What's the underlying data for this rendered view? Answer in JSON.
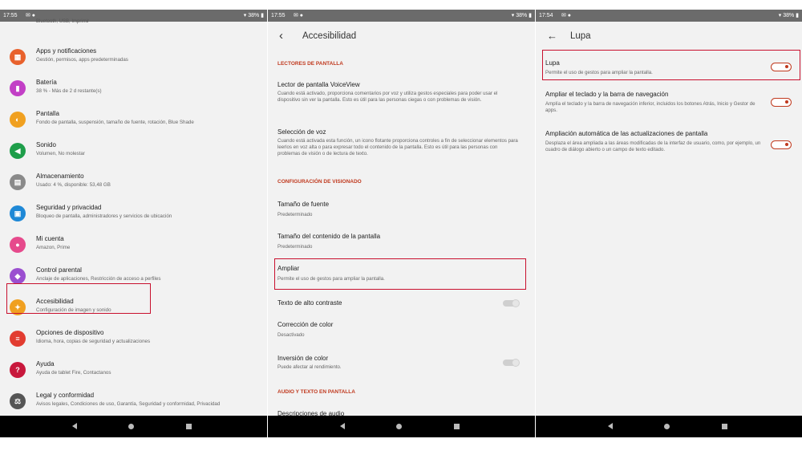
{
  "colors": {
    "accent": "#c0391e",
    "highlight": "#c8102e",
    "status_bar": "#6b6b6b",
    "nav_bar": "#000000"
  },
  "panel1": {
    "status": {
      "time": "17:55",
      "battery": "38%"
    },
    "cut_text": "Bluetooth, USB, Imprimir",
    "items": [
      {
        "title": "Apps y notificaciones",
        "subtitle": "Gestión, permisos, apps predeterminadas",
        "icon": "apps-icon",
        "color": "#e8612c"
      },
      {
        "title": "Batería",
        "subtitle": "38 % - Más de 2 d restante(s)",
        "icon": "battery-icon",
        "color": "#c23fc6"
      },
      {
        "title": "Pantalla",
        "subtitle": "Fondo de pantalla, suspensión, tamaño de fuente, rotación, Blue Shade",
        "icon": "display-icon",
        "color": "#f0a020"
      },
      {
        "title": "Sonido",
        "subtitle": "Volumen, No molestar",
        "icon": "sound-icon",
        "color": "#1e9e4a"
      },
      {
        "title": "Almacenamiento",
        "subtitle": "Usado: 4 %, disponible: 53,48 GB",
        "icon": "storage-icon",
        "color": "#8a8a8a"
      },
      {
        "title": "Seguridad y privacidad",
        "subtitle": "Bloqueo de pantalla, administradores y servicios de ubicación",
        "icon": "lock-icon",
        "color": "#1e88d6"
      },
      {
        "title": "Mi cuenta",
        "subtitle": "Amazon, Prime",
        "icon": "account-icon",
        "color": "#e64a8c"
      },
      {
        "title": "Control parental",
        "subtitle": "Anclaje de aplicaciones, Restricción de acceso a perfiles",
        "icon": "parental-icon",
        "color": "#9b4fd0"
      },
      {
        "title": "Accesibilidad",
        "subtitle": "Configuración de imagen y sonido",
        "icon": "accessibility-icon",
        "color": "#f0a020"
      },
      {
        "title": "Opciones de dispositivo",
        "subtitle": "Idioma, hora, copias de seguridad y actualizaciones",
        "icon": "device-options-icon",
        "color": "#e23c30"
      },
      {
        "title": "Ayuda",
        "subtitle": "Ayuda de tablet Fire, Contactanos",
        "icon": "help-icon",
        "color": "#c8183c"
      },
      {
        "title": "Legal y conformidad",
        "subtitle": "Avisos legales, Condiciones de uso, Garantía, Seguridad y conformidad, Privacidad",
        "icon": "legal-icon",
        "color": "#555555"
      }
    ]
  },
  "panel2": {
    "status": {
      "time": "17:55",
      "battery": "38%"
    },
    "title": "Accesibilidad",
    "section_screen_readers": "LECTORES DE PANTALLA",
    "voiceview_title": "Lector de pantalla VoiceView",
    "voiceview_sub": "Cuando está activado, proporciona comentarios por voz y utiliza gestos especiales para poder usar el dispositivo sin ver la pantalla. Esto es útil para las personas ciegas o con problemas de visión.",
    "voice_select_title": "Selección de voz",
    "voice_select_sub": "Cuando está activada esta función, un icono flotante proporciona controles a fin de seleccionar elementos para leerlos en voz alta o para expresar todo el contenido de la pantalla. Esto es útil para las personas con problemas de visión o de lectura de texto.",
    "section_display": "CONFIGURACIÓN DE VISIONADO",
    "font_size_title": "Tamaño de fuente",
    "font_size_sub": "Predeterminado",
    "content_size_title": "Tamaño del contenido de la pantalla",
    "content_size_sub": "Predeterminado",
    "magnify_title": "Ampliar",
    "magnify_sub": "Permite el uso de gestos para ampliar la pantalla.",
    "high_contrast_title": "Texto de alto contraste",
    "color_correction_title": "Corrección de color",
    "color_correction_sub": "Desactivado",
    "color_inversion_title": "Inversión de color",
    "color_inversion_sub": "Puede afectar al rendimiento.",
    "section_audio": "AUDIO Y TEXTO EN PANTALLA",
    "audio_desc_title": "Descripciones de audio"
  },
  "panel3": {
    "status": {
      "time": "17:54",
      "battery": "38%"
    },
    "title": "Lupa",
    "lupa_title": "Lupa",
    "lupa_sub": "Permite el uso de gestos para ampliar la pantalla.",
    "keyboard_title": "Ampliar el teclado y la barra de navegación",
    "keyboard_sub": "Amplía el teclado y la barra de navegación inferior, incluidos los botones Atrás, Inicio y Gestor de apps.",
    "auto_title": "Ampliación automática de las actualizaciones de pantalla",
    "auto_sub": "Desplaza el área ampliada a las áreas modificadas de la interfaz de usuario, como, por ejemplo, un cuadro de diálogo abierto o un campo de texto editado."
  }
}
